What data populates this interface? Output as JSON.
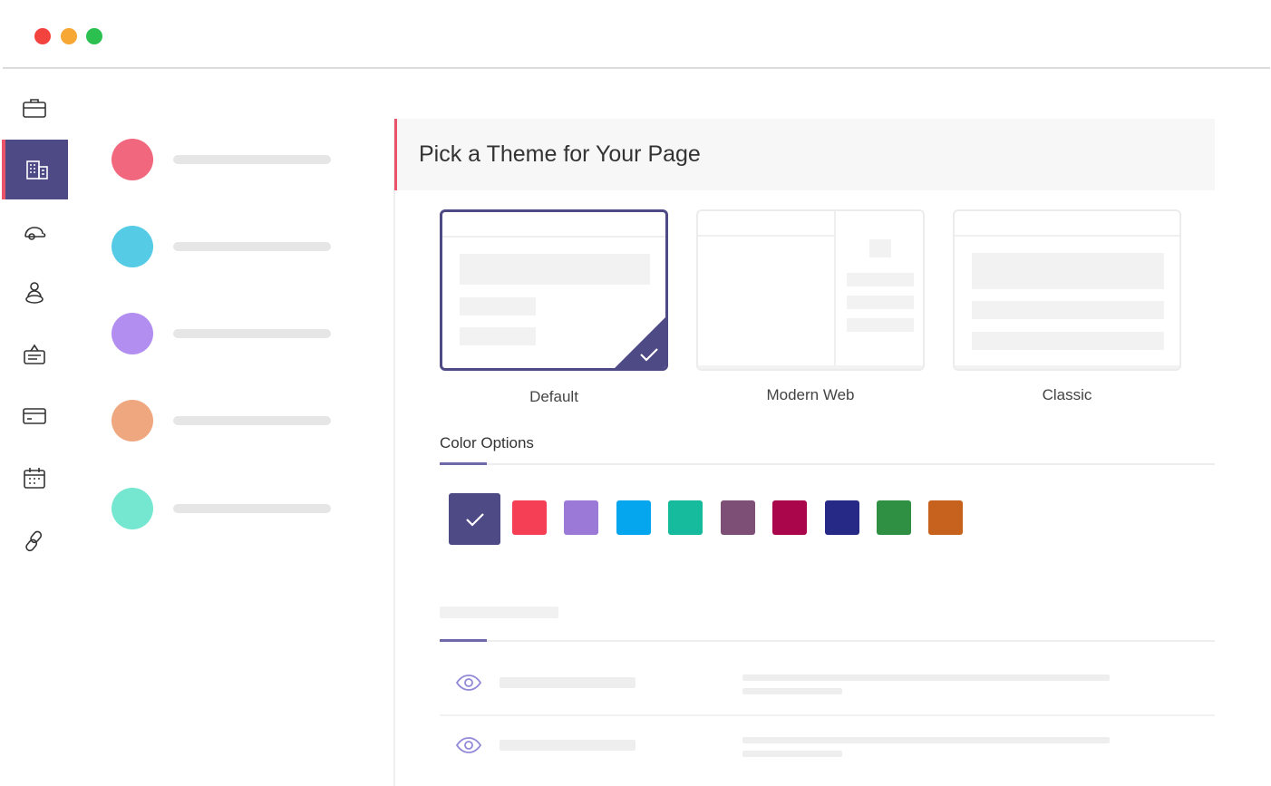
{
  "window": {
    "controls": [
      {
        "name": "close",
        "color": "#f2433f"
      },
      {
        "name": "minimize",
        "color": "#f7a733"
      },
      {
        "name": "maximize",
        "color": "#2bc04f"
      }
    ]
  },
  "sidebar": {
    "icons": [
      "briefcase-icon",
      "building-icon",
      "cap-icon",
      "people-icon",
      "badge-icon",
      "card-icon",
      "calendar-icon",
      "link-icon"
    ],
    "active_index": 1,
    "active_color": "#4e4a85",
    "active_marker_color": "#e9546b"
  },
  "list": {
    "avatar_colors": [
      "#f0677e",
      "#56cbe5",
      "#b28ef0",
      "#efa77f",
      "#75e7d0"
    ]
  },
  "panel": {
    "title": "Pick a Theme for Your Page",
    "themes": [
      {
        "label": "Default",
        "selected": true
      },
      {
        "label": "Modern Web",
        "selected": false
      },
      {
        "label": "Classic",
        "selected": false
      }
    ],
    "color_section_title": "Color Options",
    "colors": [
      "#4e4a85",
      "#f43f54",
      "#9b79d6",
      "#06a6ef",
      "#15bb9c",
      "#7d4f77",
      "#a9064c",
      "#262a86",
      "#2f8f42",
      "#c7621e"
    ],
    "selected_color_index": 0,
    "accent_color": "#4e4a85"
  }
}
